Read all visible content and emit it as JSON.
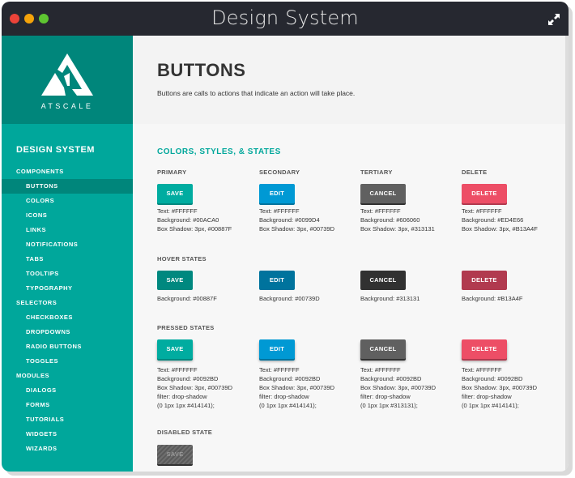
{
  "window": {
    "title": "Design System",
    "traffic_lights": [
      "#ec4339",
      "#f5a30a",
      "#5ec531"
    ],
    "expand_icon": "expand-arrows-icon"
  },
  "sidebar": {
    "logo_text": "ATSCALE",
    "heading": "DESIGN SYSTEM",
    "items": [
      {
        "label": "COMPONENTS",
        "type": "group"
      },
      {
        "label": "BUTTONS",
        "type": "sub",
        "active": true
      },
      {
        "label": "COLORS",
        "type": "sub"
      },
      {
        "label": "ICONS",
        "type": "sub"
      },
      {
        "label": "LINKS",
        "type": "sub"
      },
      {
        "label": "NOTIFICATIONS",
        "type": "sub"
      },
      {
        "label": "TABS",
        "type": "sub"
      },
      {
        "label": "TOOLTIPS",
        "type": "sub"
      },
      {
        "label": "TYPOGRAPHY",
        "type": "sub"
      },
      {
        "label": "SELECTORS",
        "type": "group"
      },
      {
        "label": "CHECKBOXES",
        "type": "sub"
      },
      {
        "label": "DROPDOWNS",
        "type": "sub"
      },
      {
        "label": "RADIO BUTTONS",
        "type": "sub"
      },
      {
        "label": "TOGGLES",
        "type": "sub"
      },
      {
        "label": "MODULES",
        "type": "group"
      },
      {
        "label": "DIALOGS",
        "type": "sub"
      },
      {
        "label": "FORMS",
        "type": "sub"
      },
      {
        "label": "TUTORIALS",
        "type": "sub"
      },
      {
        "label": "WIDGETS",
        "type": "sub"
      },
      {
        "label": "WIZARDS",
        "type": "sub"
      }
    ]
  },
  "header": {
    "title": "BUTTONS",
    "description": "Buttons are calls to actions that indicate an action will take place."
  },
  "main": {
    "section_title": "COLORS, STYLES, & STATES",
    "columns": [
      "PRIMARY",
      "SECONDARY",
      "TERTIARY",
      "DELETE"
    ],
    "default": {
      "buttons": [
        {
          "label": "SAVE",
          "bg": "#00ACA0",
          "shadow": "#00887F",
          "desc": [
            "Text: #FFFFFF",
            "Background: #00ACA0",
            "Box Shadow: 3px, #00887F"
          ]
        },
        {
          "label": "EDIT",
          "bg": "#0099D4",
          "shadow": "#00739D",
          "desc": [
            "Text: #FFFFFF",
            "Background: #0099D4",
            "Box Shadow: 3px, #00739D"
          ]
        },
        {
          "label": "CANCEL",
          "bg": "#606060",
          "shadow": "#313131",
          "desc": [
            "Text: #FFFFFF",
            "Background: #606060",
            "Box Shadow: 3px, #313131"
          ]
        },
        {
          "label": "DELETE",
          "bg": "#ED4E66",
          "shadow": "#B13A4F",
          "desc": [
            "Text: #FFFFFF",
            "Background: #ED4E66",
            "Box Shadow: 3px, #B13A4F"
          ]
        }
      ]
    },
    "hover": {
      "label": "HOVER STATES",
      "buttons": [
        {
          "label": "SAVE",
          "bg": "#00887F",
          "desc": [
            "Background: #00887F"
          ]
        },
        {
          "label": "EDIT",
          "bg": "#00739D",
          "desc": [
            "Background: #00739D"
          ]
        },
        {
          "label": "CANCEL",
          "bg": "#313131",
          "desc": [
            "Background: #313131"
          ]
        },
        {
          "label": "DELETE",
          "bg": "#B13A4F",
          "desc": [
            "Background: #B13A4F"
          ]
        }
      ]
    },
    "pressed": {
      "label": "PRESSED STATES",
      "buttons": [
        {
          "label": "SAVE",
          "bg": "#00ACA0",
          "shadow": "#00887F",
          "desc": [
            "Text: #FFFFFF",
            "Background: #0092BD",
            "Box Shadow: 3px, #00739D",
            "filter: drop-shadow",
            "(0 1px 1px #414141);"
          ]
        },
        {
          "label": "EDIT",
          "bg": "#0099D4",
          "shadow": "#00739D",
          "desc": [
            "Text: #FFFFFF",
            "Background: #0092BD",
            "Box Shadow: 3px, #00739D",
            "filter: drop-shadow",
            "(0 1px 1px #414141);"
          ]
        },
        {
          "label": "CANCEL",
          "bg": "#606060",
          "shadow": "#313131",
          "desc": [
            "Text: #FFFFFF",
            "Background: #0092BD",
            "Box Shadow: 3px, #00739D",
            "filter: drop-shadow",
            "(0 1px 1px #313131);"
          ]
        },
        {
          "label": "DELETE",
          "bg": "#ED4E66",
          "shadow": "#B13A4F",
          "desc": [
            "Text: #FFFFFF",
            "Background: #0092BD",
            "Box Shadow: 3px, #00739D",
            "filter: drop-shadow",
            "(0 1px 1px #414141);"
          ]
        }
      ]
    },
    "disabled": {
      "label": "DISABLED STATE",
      "button_label": "SAVE"
    }
  }
}
